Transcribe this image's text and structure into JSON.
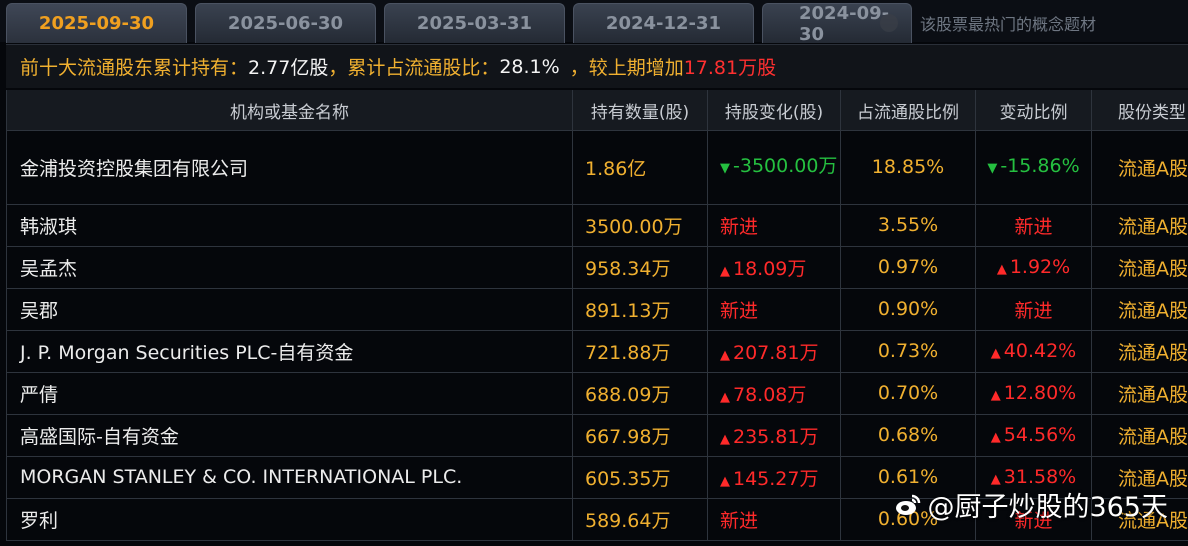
{
  "tabs": [
    {
      "label": "2025-09-30",
      "active": true
    },
    {
      "label": "2025-06-30",
      "active": false
    },
    {
      "label": "2025-03-31",
      "active": false
    },
    {
      "label": "2024-12-31",
      "active": false
    },
    {
      "label": "2024-09-30",
      "active": false
    }
  ],
  "search": {
    "placeholder": "该股票最热门的概念题材"
  },
  "summary": {
    "label1": "前十大流通股东累计持有：",
    "value1": "2.77亿股",
    "label2": "，累计占流通股比：",
    "value2": "28.1%",
    "label3": "，较上期增加",
    "value3": "17.81万股"
  },
  "table": {
    "headers": [
      "机构或基金名称",
      "持有数量(股)",
      "持股变化(股)",
      "占流通股比例",
      "变动比例",
      "股份类型"
    ],
    "rows": [
      {
        "name": "金浦投资控股集团有限公司",
        "qty": "1.86亿",
        "change": "-3500.00万",
        "change_dir": "down",
        "ratio": "18.85%",
        "pct": "-15.86%",
        "pct_dir": "down",
        "type": "流通A股"
      },
      {
        "name": "韩淑琪",
        "qty": "3500.00万",
        "change": "新进",
        "change_dir": "new",
        "ratio": "3.55%",
        "pct": "新进",
        "pct_dir": "new",
        "type": "流通A股"
      },
      {
        "name": "吴孟杰",
        "qty": "958.34万",
        "change": "18.09万",
        "change_dir": "up",
        "ratio": "0.97%",
        "pct": "1.92%",
        "pct_dir": "up",
        "type": "流通A股"
      },
      {
        "name": "吴郡",
        "qty": "891.13万",
        "change": "新进",
        "change_dir": "new",
        "ratio": "0.90%",
        "pct": "新进",
        "pct_dir": "new",
        "type": "流通A股"
      },
      {
        "name": "J. P. Morgan Securities PLC-自有资金",
        "qty": "721.88万",
        "change": "207.81万",
        "change_dir": "up",
        "ratio": "0.73%",
        "pct": "40.42%",
        "pct_dir": "up",
        "type": "流通A股"
      },
      {
        "name": "严倩",
        "qty": "688.09万",
        "change": "78.08万",
        "change_dir": "up",
        "ratio": "0.70%",
        "pct": "12.80%",
        "pct_dir": "up",
        "type": "流通A股"
      },
      {
        "name": "高盛国际-自有资金",
        "qty": "667.98万",
        "change": "235.81万",
        "change_dir": "up",
        "ratio": "0.68%",
        "pct": "54.56%",
        "pct_dir": "up",
        "type": "流通A股"
      },
      {
        "name": "MORGAN STANLEY & CO. INTERNATIONAL PLC.",
        "qty": "605.35万",
        "change": "145.27万",
        "change_dir": "up",
        "ratio": "0.61%",
        "pct": "31.58%",
        "pct_dir": "up",
        "type": "流通A股"
      },
      {
        "name": "罗利",
        "qty": "589.64万",
        "change": "新进",
        "change_dir": "new",
        "ratio": "0.60%",
        "pct": "新进",
        "pct_dir": "new",
        "type": "流通A股"
      }
    ]
  },
  "watermark": {
    "text": "@厨子炒股的365天"
  },
  "colors": {
    "accent": "#f0b030",
    "up": "#ff2a2a",
    "down": "#25c040",
    "background": "#05070b"
  }
}
